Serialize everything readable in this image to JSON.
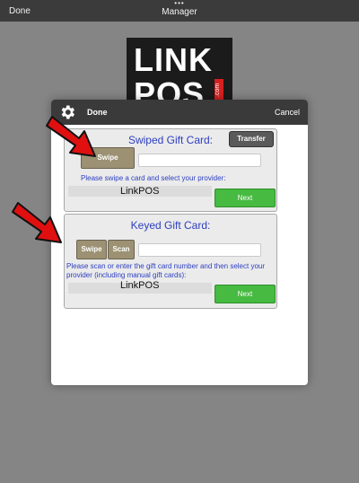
{
  "topbar": {
    "done": "Done",
    "title": "Manager",
    "dots": "•••"
  },
  "logo": {
    "line1": "LINK",
    "line2": "POS",
    "com": ".com"
  },
  "modal": {
    "done": "Done",
    "cancel": "Cancel"
  },
  "swiped": {
    "title": "Swiped Gift Card:",
    "transfer": "Transfer",
    "swipe": "Swipe",
    "message": "Please swipe a card and select your provider:",
    "provider": "LinkPOS",
    "next": "Next"
  },
  "keyed": {
    "title": "Keyed Gift Card:",
    "swipe": "Swipe",
    "scan": "Scan",
    "message": "Please scan or enter the gift card number and then select your provider (including manual gift cards):",
    "provider": "LinkPOS",
    "next": "Next"
  },
  "colors": {
    "green": "#46ba41",
    "gold": "#9c9173",
    "blue_text": "#2c3ec0",
    "arrow_red": "#e01010"
  }
}
